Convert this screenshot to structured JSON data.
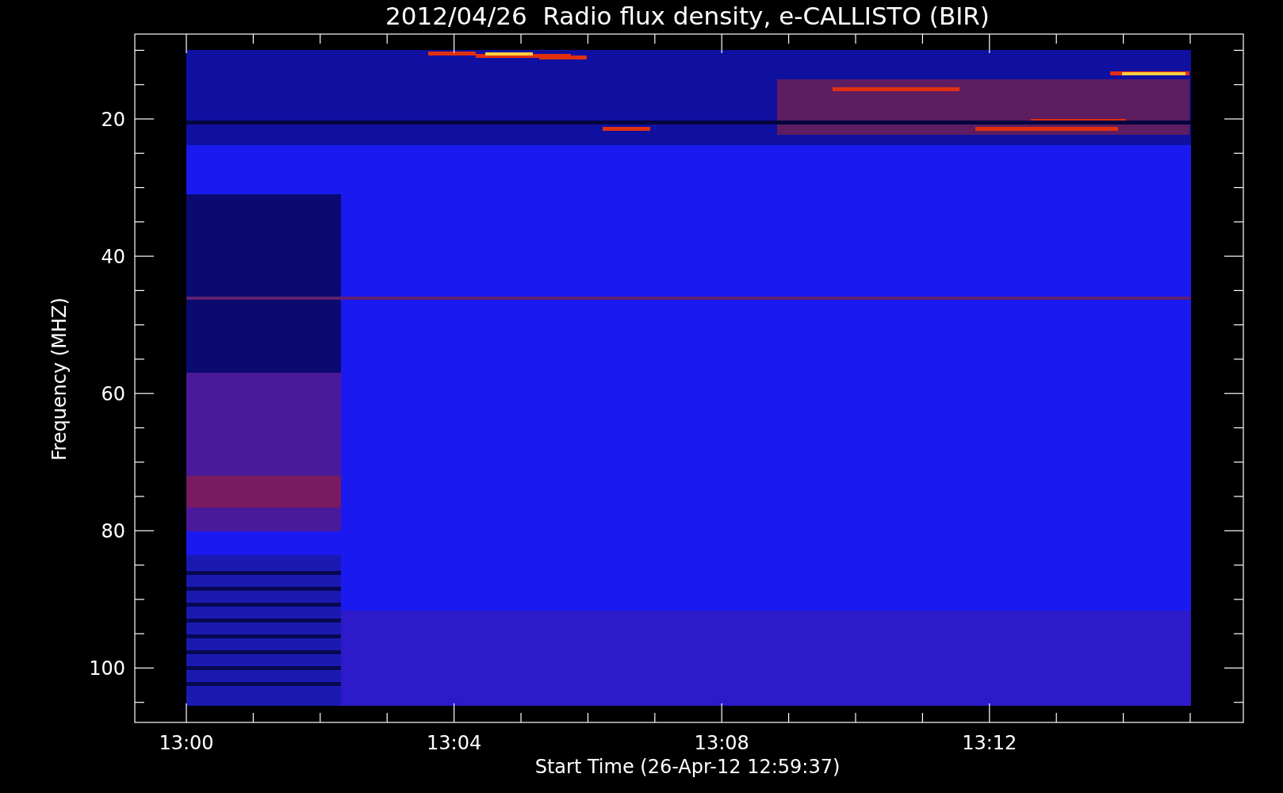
{
  "title": "2012/04/26  Radio flux density, e-CALLISTO (BIR)",
  "ylabel": "Frequency (MHZ)",
  "xlabel": "Start Time (26-Apr-12 12:59:37)",
  "yticks": [
    "20",
    "40",
    "60",
    "80",
    "100"
  ],
  "xticks": [
    "13:00",
    "13:04",
    "13:08",
    "13:12"
  ]
}
